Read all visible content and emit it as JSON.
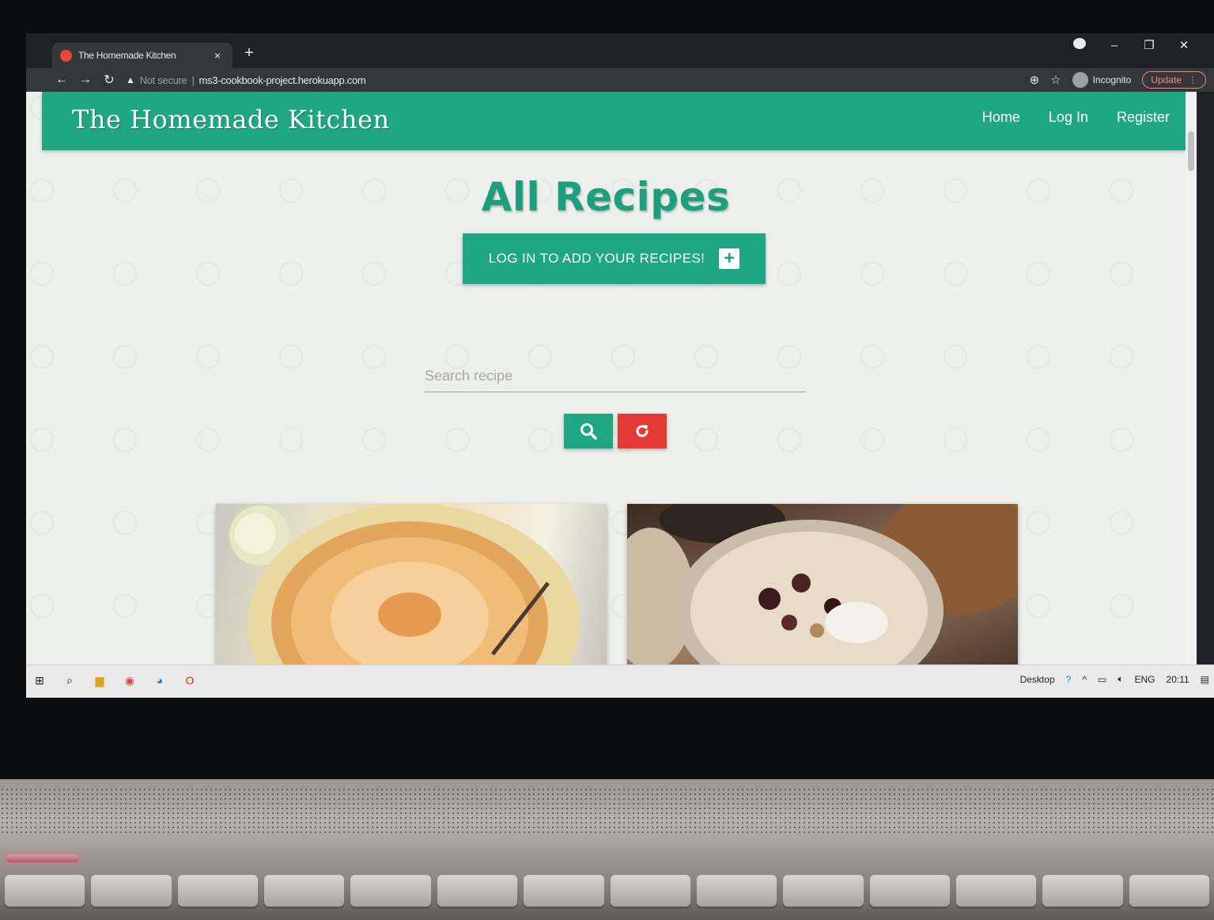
{
  "browser": {
    "tab_title": "The Homemade Kitchen",
    "tab_close": "×",
    "new_tab": "+",
    "security_label": "Not secure",
    "url": "ms3-cookbook-project.herokuapp.com",
    "incognito_label": "Incognito",
    "update_label": "Update",
    "icons": [
      "back-arrow-icon",
      "forward-arrow-icon",
      "reload-icon",
      "zoom-icon",
      "star-icon",
      "menu-dots-icon"
    ]
  },
  "navbar": {
    "brand": "The Homemade Kitchen",
    "links": [
      "Home",
      "Log In",
      "Register"
    ]
  },
  "main": {
    "title": "All Recipes",
    "login_cta": "LOG IN TO ADD YOUR RECIPES!",
    "search_placeholder": "Search recipe",
    "search_value": ""
  },
  "recipes": [
    {
      "image": "apple-tart-photo"
    },
    {
      "image": "oatmeal-bowl-photo"
    }
  ],
  "taskbar": {
    "desktop_label": "Desktop",
    "language": "ENG",
    "time": "20:11"
  },
  "colors": {
    "brand_green": "#1fa683",
    "title_green": "#1f9e7e",
    "reset_red": "#e53935"
  }
}
